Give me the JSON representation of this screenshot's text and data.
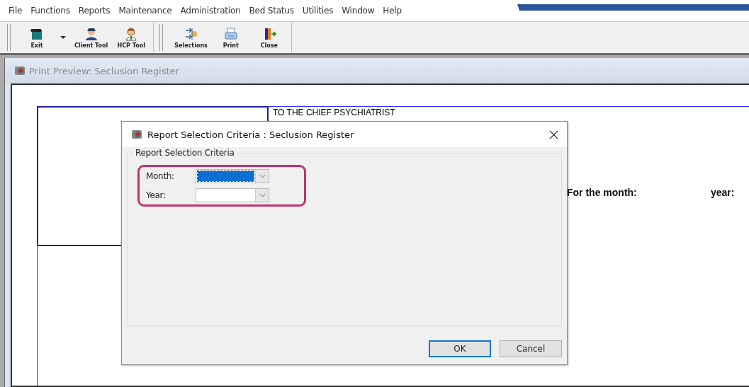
{
  "menu": [
    "File",
    "Functions",
    "Reports",
    "Maintenance",
    "Administration",
    "Bed Status",
    "Utilities",
    "Window",
    "Help"
  ],
  "toolbar_groups": [
    [
      {
        "label": "Exit",
        "dropdown": true
      },
      {
        "label": "Client Tool",
        "dropdown": false
      },
      {
        "label": "HCP Tool",
        "dropdown": false
      }
    ],
    [
      {
        "label": "Selections",
        "dropdown": false
      },
      {
        "label": "Print",
        "dropdown": false
      },
      {
        "label": "Close",
        "dropdown": false
      }
    ]
  ],
  "child_window": {
    "title": "Print Preview: Seclusion Register"
  },
  "report_page": {
    "heading": "TO THE CHIEF PSYCHIATRIST",
    "month_label": "For the month:",
    "year_label": "year:"
  },
  "dialog": {
    "title": "Report Selection Criteria : Seclusion Register",
    "group_label": "Report Selection Criteria",
    "highlighted": true,
    "fields": [
      {
        "label": "Month:",
        "focused": true
      },
      {
        "label": "Year:",
        "focused": false
      }
    ],
    "buttons": [
      {
        "label": "OK",
        "default": true
      },
      {
        "label": "Cancel",
        "default": false
      }
    ]
  }
}
